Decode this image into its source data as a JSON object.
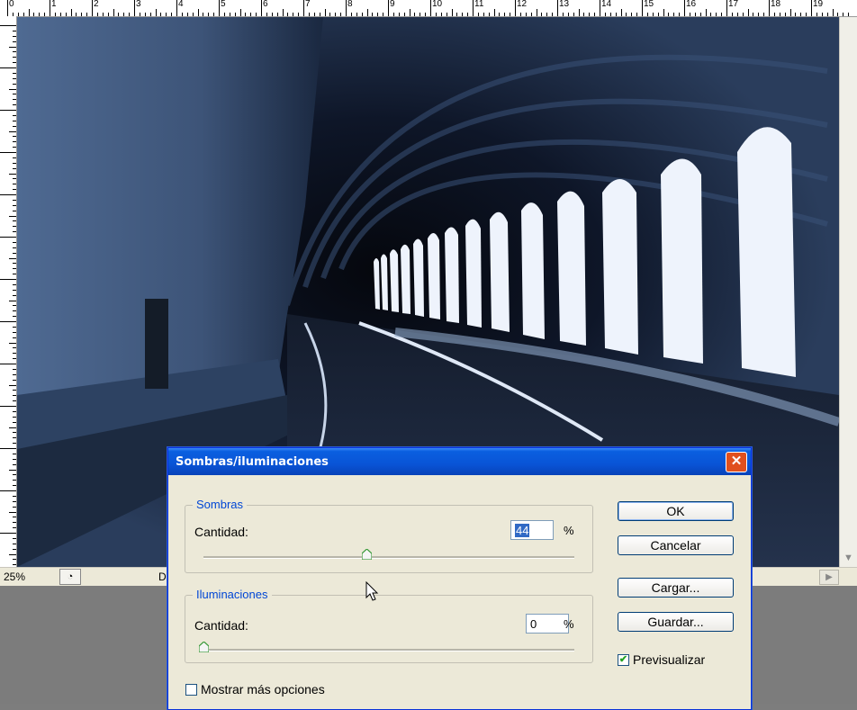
{
  "ruler": {
    "top_numbers": [
      "0",
      "1",
      "2",
      "3",
      "4",
      "5",
      "6",
      "7",
      "8",
      "9",
      "10",
      "11",
      "12",
      "13",
      "14",
      "15",
      "16",
      "17",
      "18",
      "19"
    ]
  },
  "status_bar": {
    "zoom": "25%",
    "doc_label": "D"
  },
  "dialog": {
    "title": "Sombras/iluminaciones",
    "shadows": {
      "group_label": "Sombras",
      "amount_label": "Cantidad:",
      "amount_value": "44",
      "amount_fraction": 0.44,
      "unit": "%"
    },
    "highlights": {
      "group_label": "Iluminaciones",
      "amount_label": "Cantidad:",
      "amount_value": "0",
      "amount_fraction": 0.0,
      "unit": "%"
    },
    "buttons": {
      "ok": "OK",
      "cancel": "Cancelar",
      "load": "Cargar...",
      "save": "Guardar..."
    },
    "preview": {
      "label": "Previsualizar",
      "checked": true
    },
    "more_options": {
      "label": "Mostrar más opciones",
      "checked": false
    }
  },
  "colors": {
    "titlebar": "#0a5fe0",
    "group_label": "#0046d5",
    "close_button": "#e0501e"
  }
}
